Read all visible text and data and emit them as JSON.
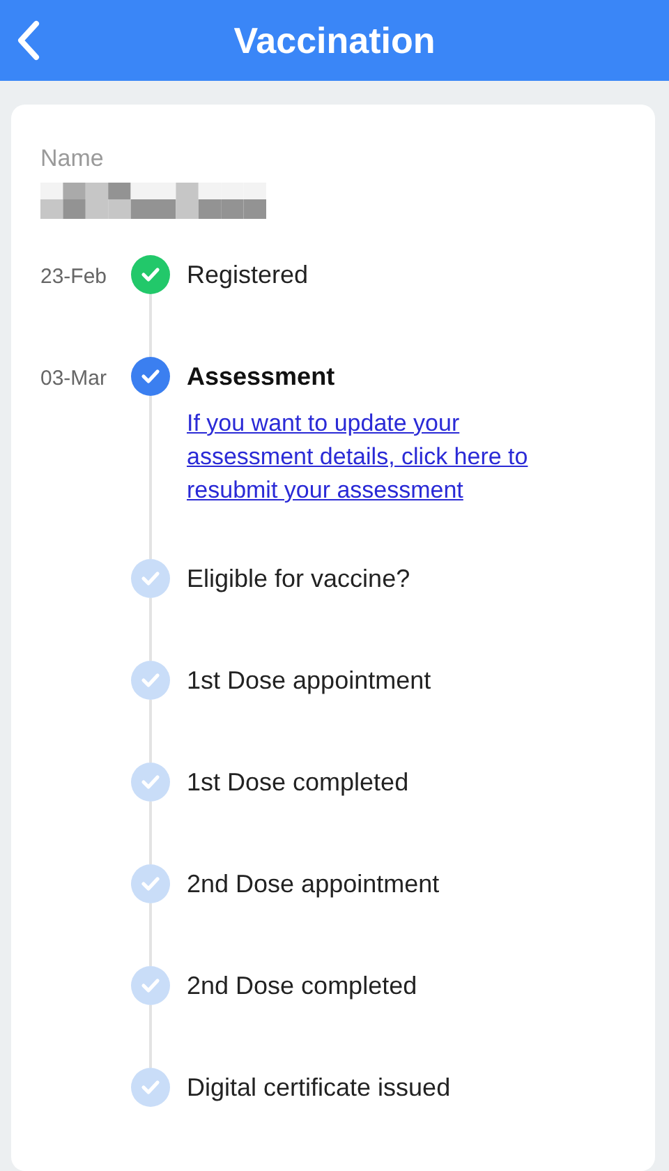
{
  "header": {
    "title": "Vaccination"
  },
  "name_field": {
    "label": "Name"
  },
  "steps": [
    {
      "date": "23-Feb",
      "label": "Registered",
      "kind": "done"
    },
    {
      "date": "03-Mar",
      "label": "Assessment",
      "kind": "current",
      "link": "If you want to update your assessment details, click here to resubmit your assessment"
    },
    {
      "label": "Eligible for vaccine?",
      "kind": "pending"
    },
    {
      "label": "1st Dose appointment",
      "kind": "pending"
    },
    {
      "label": "1st Dose completed",
      "kind": "pending"
    },
    {
      "label": "2nd Dose appointment",
      "kind": "pending"
    },
    {
      "label": "2nd Dose completed",
      "kind": "pending"
    },
    {
      "label": "Digital certificate issued",
      "kind": "pending"
    }
  ]
}
